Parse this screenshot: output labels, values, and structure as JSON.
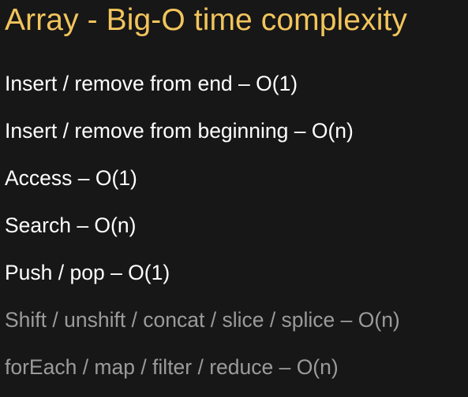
{
  "slide": {
    "title": "Array - Big-O time complexity",
    "title_color": "#f2c45c",
    "text_color": "#ffffff",
    "dim_text_color": "#9b9b9b",
    "items": [
      {
        "text": "Insert / remove from end – O(1)",
        "dimmed": false
      },
      {
        "text": "Insert / remove from beginning – O(n)",
        "dimmed": false
      },
      {
        "text": "Access – O(1)",
        "dimmed": false
      },
      {
        "text": "Search – O(n)",
        "dimmed": false
      },
      {
        "text": "Push / pop – O(1)",
        "dimmed": false
      },
      {
        "text": "Shift / unshift / concat / slice / splice – O(n)",
        "dimmed": true
      },
      {
        "text": "forEach / map / filter / reduce – O(n)",
        "dimmed": true
      }
    ]
  }
}
